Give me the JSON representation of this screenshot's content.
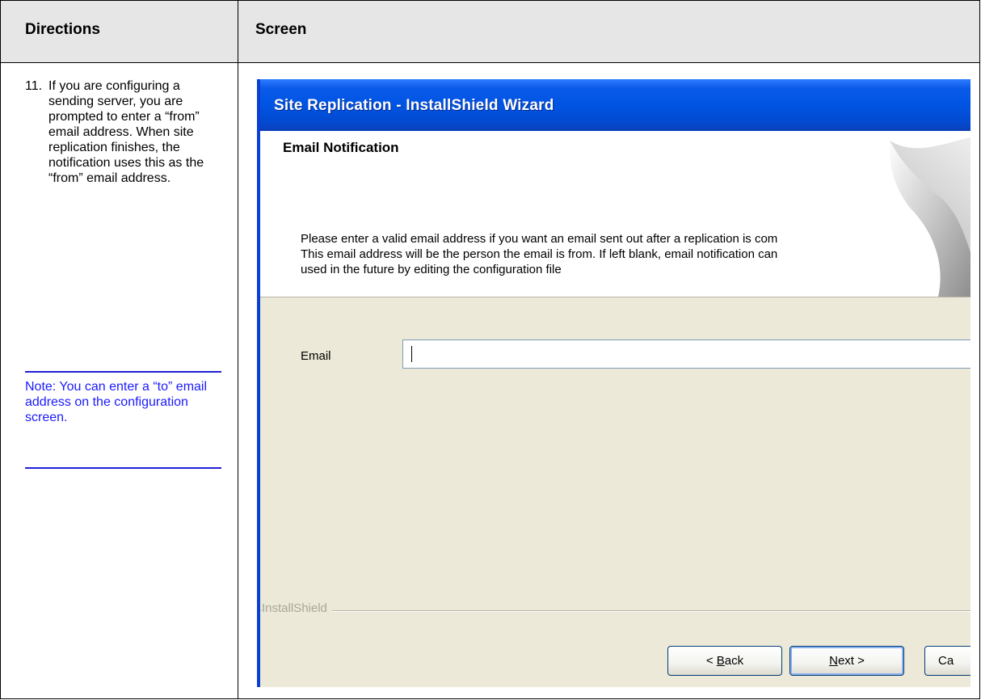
{
  "table": {
    "header_directions": "Directions",
    "header_screen": "Screen"
  },
  "directions": {
    "step_number": "11.",
    "step_text": "If you are configuring a sending server, you are prompted to enter a “from” email address. When site replication finishes, the notification uses this as the “from” email address.",
    "note": "Note: You can enter a “to” email address on the configuration screen."
  },
  "wizard": {
    "title": "Site Replication - InstallShield Wizard",
    "header_title": "Email Notification",
    "body_lines": [
      "Please enter a valid email address if you want an email sent out after a replication is com",
      "This email address will be the person the email is from. If left blank, email notification can",
      "used in the future by editing the configuration file"
    ],
    "email_label": "Email",
    "email_value": "",
    "brand": "InstallShield",
    "back_button": {
      "prefix": "< ",
      "accel": "B",
      "rest": "ack"
    },
    "next_button": {
      "accel": "N",
      "rest": "ext >"
    },
    "cancel_button": "Ca"
  },
  "colors": {
    "header_bg": "#e6e6e6",
    "note_blue": "#1a1aff",
    "titlebar_blue": "#0054e3",
    "dialog_bg": "#ece9d8"
  }
}
